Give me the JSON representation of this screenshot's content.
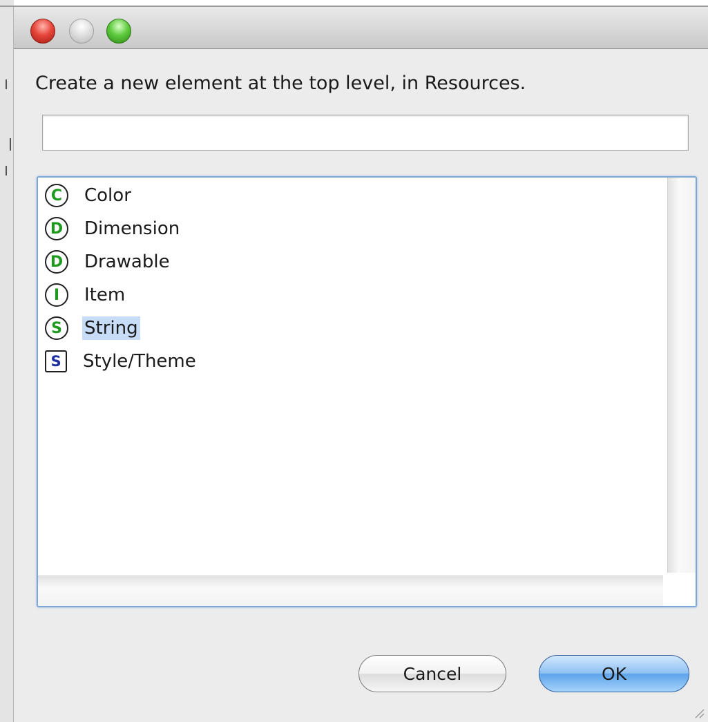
{
  "dialog": {
    "message": "Create a new element at the top level, in Resources.",
    "filter": {
      "value": "",
      "placeholder": ""
    },
    "items": [
      {
        "label": "Color",
        "icon_letter": "C",
        "icon": "color-resource-icon",
        "icon_shape": "circle",
        "selected": false
      },
      {
        "label": "Dimension",
        "icon_letter": "D",
        "icon": "dimension-resource-icon",
        "icon_shape": "circle",
        "selected": false
      },
      {
        "label": "Drawable",
        "icon_letter": "D",
        "icon": "drawable-resource-icon",
        "icon_shape": "circle",
        "selected": false
      },
      {
        "label": "Item",
        "icon_letter": "I",
        "icon": "item-resource-icon",
        "icon_shape": "circle",
        "selected": false
      },
      {
        "label": "String",
        "icon_letter": "S",
        "icon": "string-resource-icon",
        "icon_shape": "circle",
        "selected": true
      },
      {
        "label": "Style/Theme",
        "icon_letter": "S",
        "icon": "style-resource-icon",
        "icon_shape": "square",
        "selected": false
      }
    ],
    "buttons": {
      "cancel_label": "Cancel",
      "ok_label": "OK"
    }
  },
  "colors": {
    "circle_icon_letter": "#1e9a1e",
    "square_icon_letter": "#1c2fa3",
    "selection": "#c7dcf7",
    "default_button": "#6aaeef"
  }
}
